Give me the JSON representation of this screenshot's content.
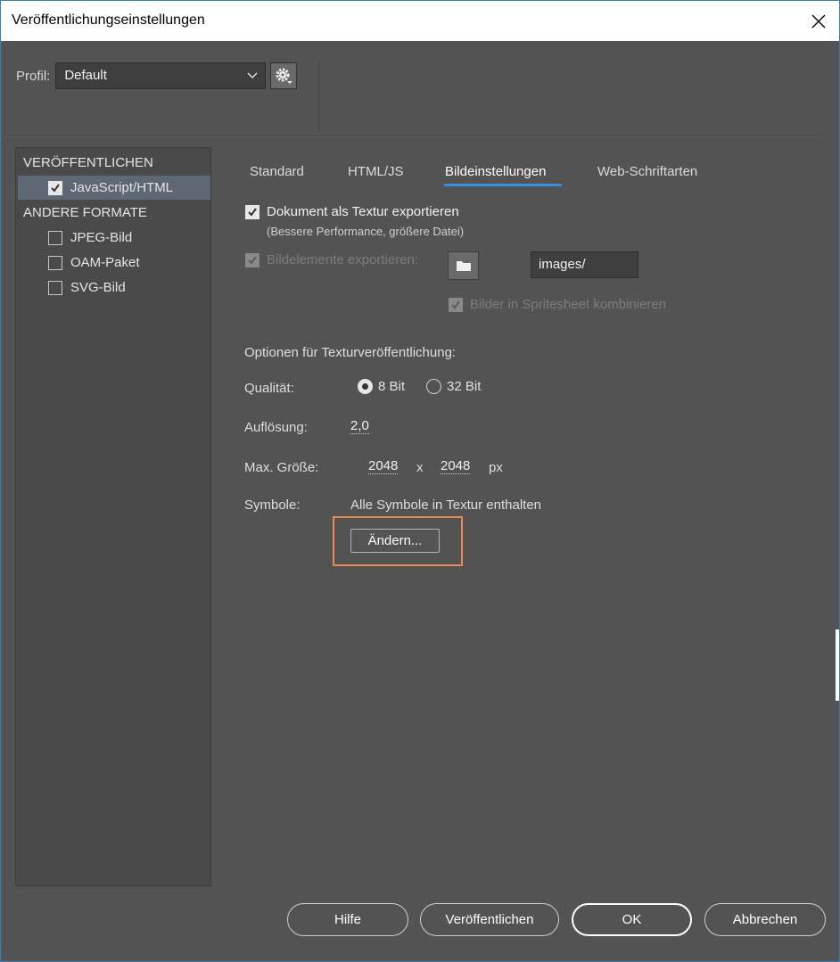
{
  "window": {
    "title": "Veröffentlichungseinstellungen"
  },
  "profile": {
    "label": "Profil:",
    "selected": "Default"
  },
  "sidebar": {
    "publish_heading": "VERÖFFENTLICHEN",
    "publish_items": [
      {
        "label": "JavaScript/HTML",
        "checked": true
      }
    ],
    "other_heading": "ANDERE FORMATE",
    "other_items": [
      {
        "label": "JPEG-Bild",
        "checked": false
      },
      {
        "label": "OAM-Paket",
        "checked": false
      },
      {
        "label": "SVG-Bild",
        "checked": false
      }
    ]
  },
  "tabs": [
    {
      "label": "Standard"
    },
    {
      "label": "HTML/JS"
    },
    {
      "label": "Bildeinstellungen",
      "active": true
    },
    {
      "label": "Web-Schriftarten"
    }
  ],
  "image_settings": {
    "export_texture_label": "Dokument als Textur exportieren",
    "export_texture_checked": true,
    "export_texture_hint": "(Bessere Performance, größere Datei)",
    "export_assets_label": "Bildelemente exportieren:",
    "export_assets_path": "images/",
    "spritesheet_label": "Bilder in Spritesheet kombinieren",
    "texture_options_heading": "Optionen für Texturveröffentlichung:",
    "quality_label": "Qualität:",
    "quality_8bit": "8 Bit",
    "quality_32bit": "32 Bit",
    "quality_selected": "8 Bit",
    "resolution_label": "Auflösung:",
    "resolution_value": "2,0",
    "max_size_label": "Max. Größe:",
    "max_width": "2048",
    "size_separator": "x",
    "max_height": "2048",
    "size_unit": "px",
    "symbols_label": "Symbole:",
    "symbols_value": "Alle Symbole in Textur enthalten",
    "change_button": "Ändern..."
  },
  "footer": {
    "help": "Hilfe",
    "publish": "Veröffentlichen",
    "ok": "OK",
    "cancel": "Abbrechen"
  },
  "colors": {
    "accent": "#3a8de0",
    "highlight": "#e98a55",
    "background": "#535353"
  }
}
